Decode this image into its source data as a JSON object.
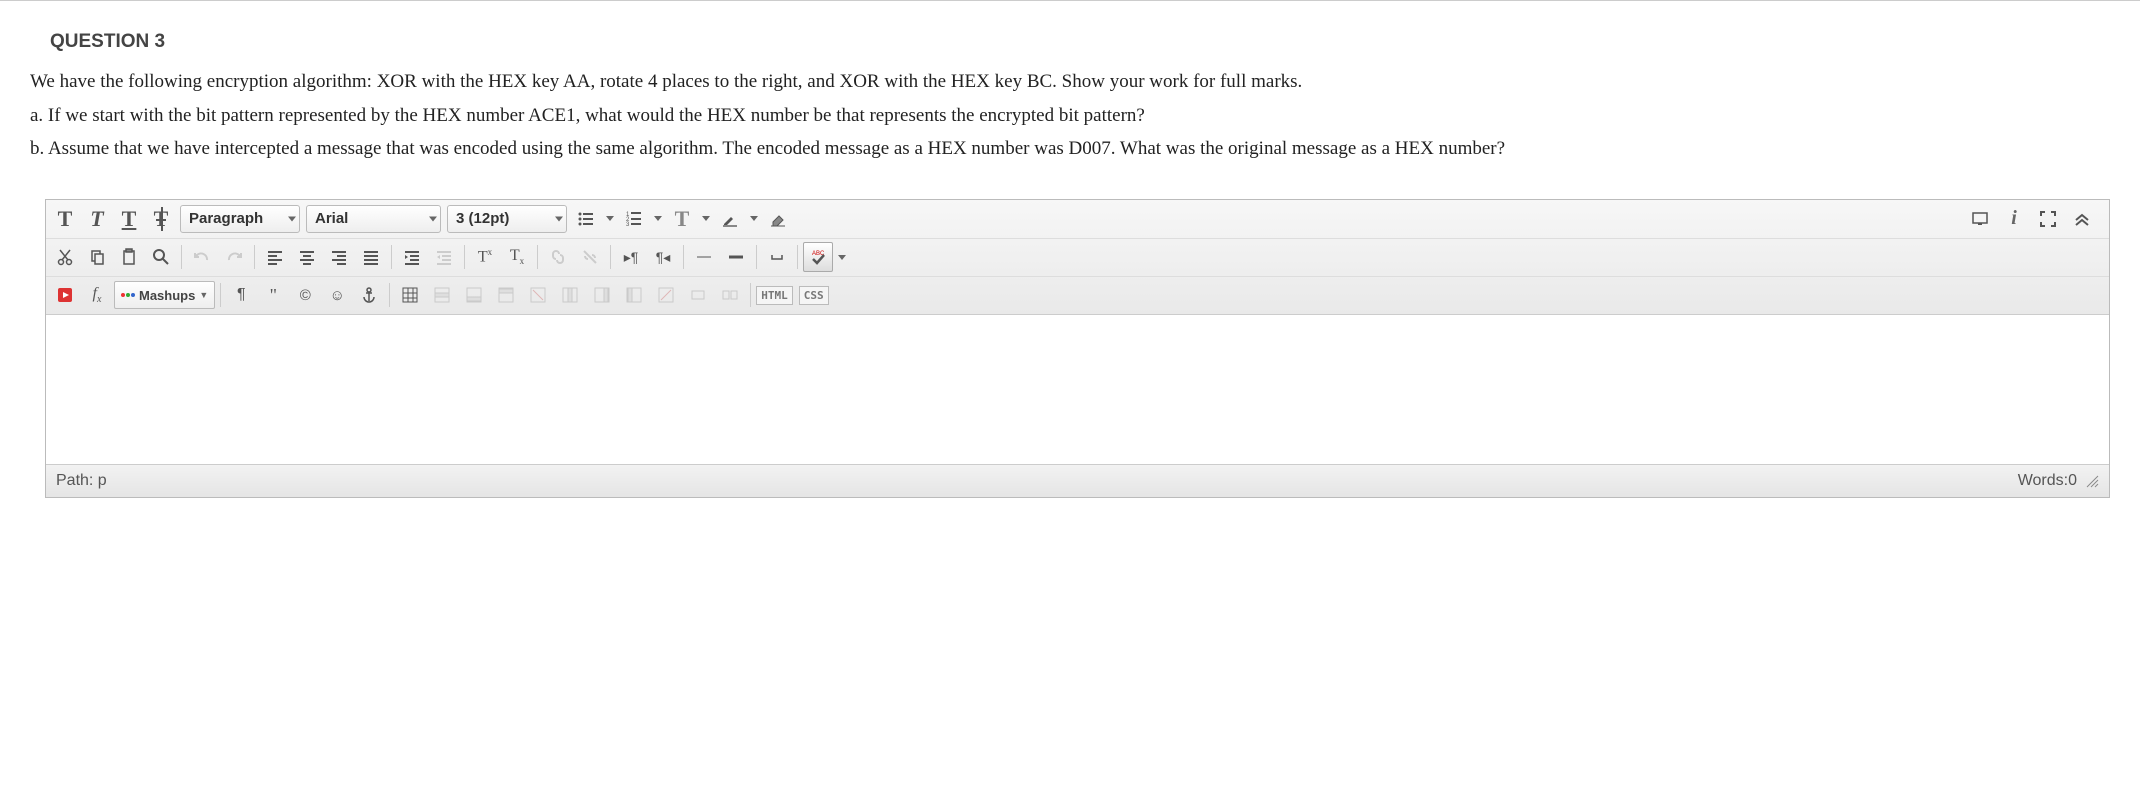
{
  "question": {
    "title": "QUESTION 3",
    "intro": "We have the following encryption algorithm: XOR with the HEX key AA, rotate 4 places to the right, and XOR with the HEX key BC. Show your work for full marks.",
    "part_a": "a. If we start with the bit pattern represented by the HEX number ACE1, what would the HEX number be that represents the encrypted bit pattern?",
    "part_b": "b. Assume that we have intercepted a message that was encoded using the same algorithm. The encoded message as a HEX number was D007. What was the original message as a HEX number?"
  },
  "editor": {
    "format_select": "Paragraph",
    "font_select": "Arial",
    "size_select": "3 (12pt)",
    "mashups_label": "Mashups",
    "html_badge": "HTML",
    "css_badge": "CSS",
    "path_label": "Path: p",
    "words_label": "Words:0"
  }
}
